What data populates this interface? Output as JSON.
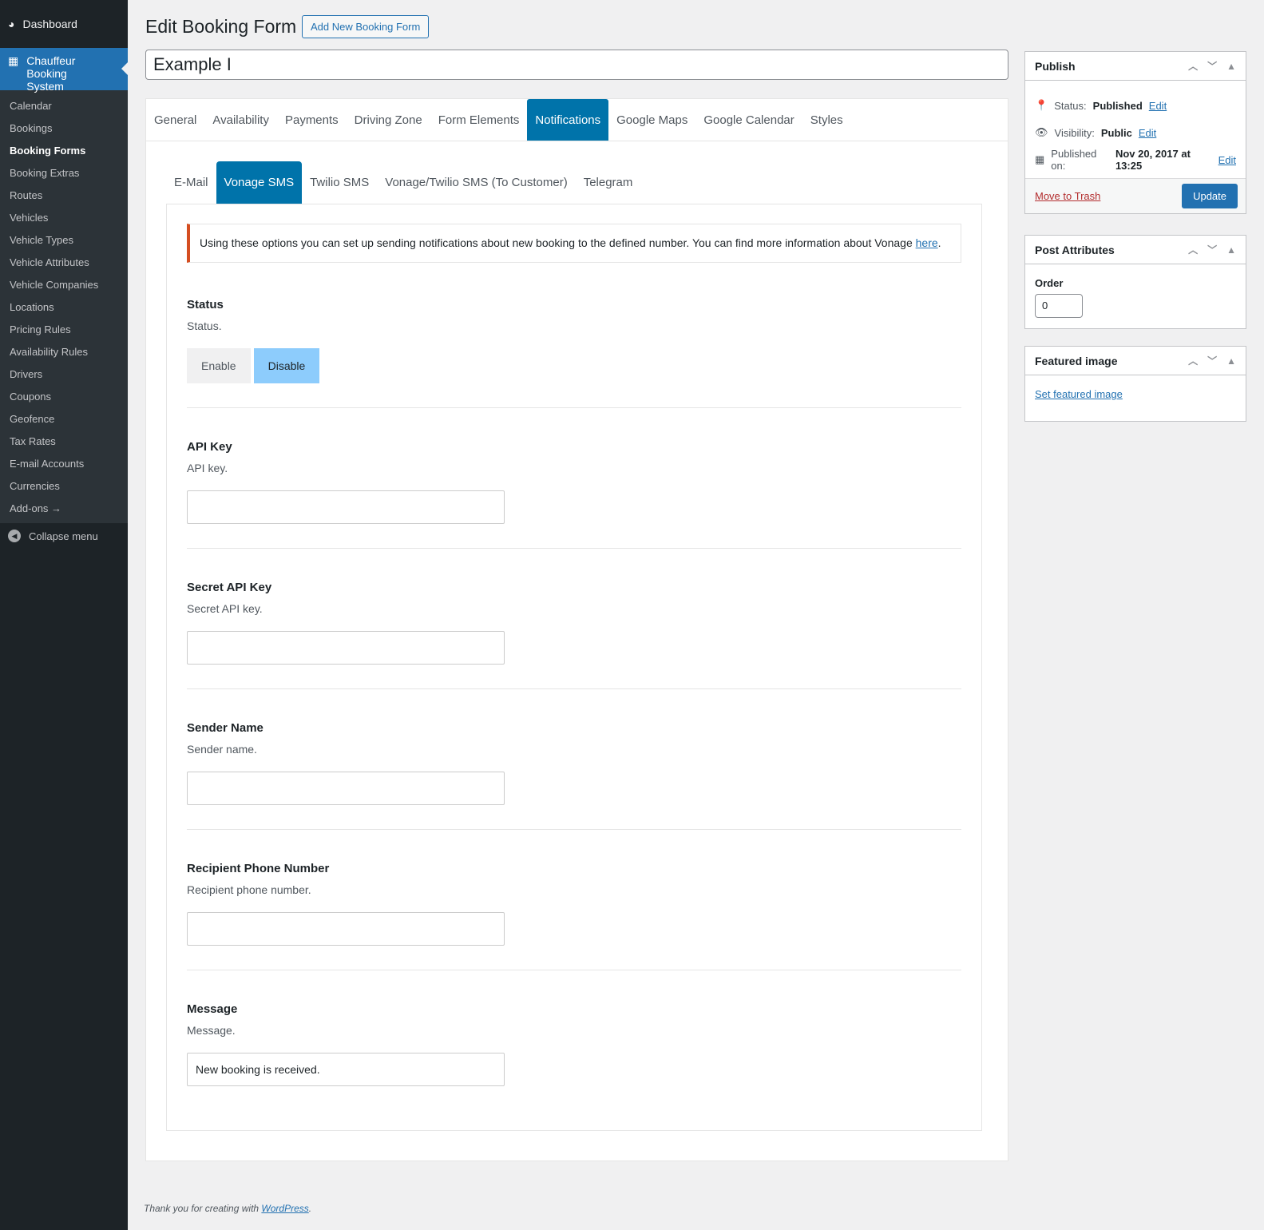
{
  "sidebar": {
    "dashboard": "Dashboard",
    "plugin": "Chauffeur Booking System",
    "items": [
      "Calendar",
      "Bookings",
      "Booking Forms",
      "Booking Extras",
      "Routes",
      "Vehicles",
      "Vehicle Types",
      "Vehicle Attributes",
      "Vehicle Companies",
      "Locations",
      "Pricing Rules",
      "Availability Rules",
      "Drivers",
      "Coupons",
      "Geofence",
      "Tax Rates",
      "E-mail Accounts",
      "Currencies",
      "Add-ons →"
    ],
    "collapse": "Collapse menu"
  },
  "header": {
    "title": "Edit Booking Form",
    "add_new": "Add New Booking Form",
    "post_title": "Example I"
  },
  "tabs": [
    "General",
    "Availability",
    "Payments",
    "Driving Zone",
    "Form Elements",
    "Notifications",
    "Google Maps",
    "Google Calendar",
    "Styles"
  ],
  "subtabs": [
    "E-Mail",
    "Vonage SMS",
    "Twilio SMS",
    "Vonage/Twilio SMS (To Customer)",
    "Telegram"
  ],
  "notice": {
    "text": "Using these options you can set up sending notifications about new booking to the defined number. You can find more information about Vonage ",
    "link": "here",
    "end": "."
  },
  "fields": {
    "status": {
      "label": "Status",
      "desc": "Status.",
      "enable": "Enable",
      "disable": "Disable"
    },
    "api_key": {
      "label": "API Key",
      "desc": "API key.",
      "value": ""
    },
    "secret": {
      "label": "Secret API Key",
      "desc": "Secret API key.",
      "value": ""
    },
    "sender": {
      "label": "Sender Name",
      "desc": "Sender name.",
      "value": ""
    },
    "phone": {
      "label": "Recipient Phone Number",
      "desc": "Recipient phone number.",
      "value": ""
    },
    "message": {
      "label": "Message",
      "desc": "Message.",
      "value": "New booking is received."
    }
  },
  "publish": {
    "title": "Publish",
    "status_label": "Status:",
    "status": "Published",
    "visibility_label": "Visibility:",
    "visibility": "Public",
    "published_label": "Published on:",
    "published": "Nov 20, 2017 at 13:25",
    "edit": "Edit",
    "trash": "Move to Trash",
    "update": "Update"
  },
  "attributes": {
    "title": "Post Attributes",
    "order_label": "Order",
    "order": "0"
  },
  "featured": {
    "title": "Featured image",
    "link": "Set featured image"
  },
  "footer": {
    "text": "Thank you for creating with ",
    "link": "WordPress",
    "end": "."
  }
}
